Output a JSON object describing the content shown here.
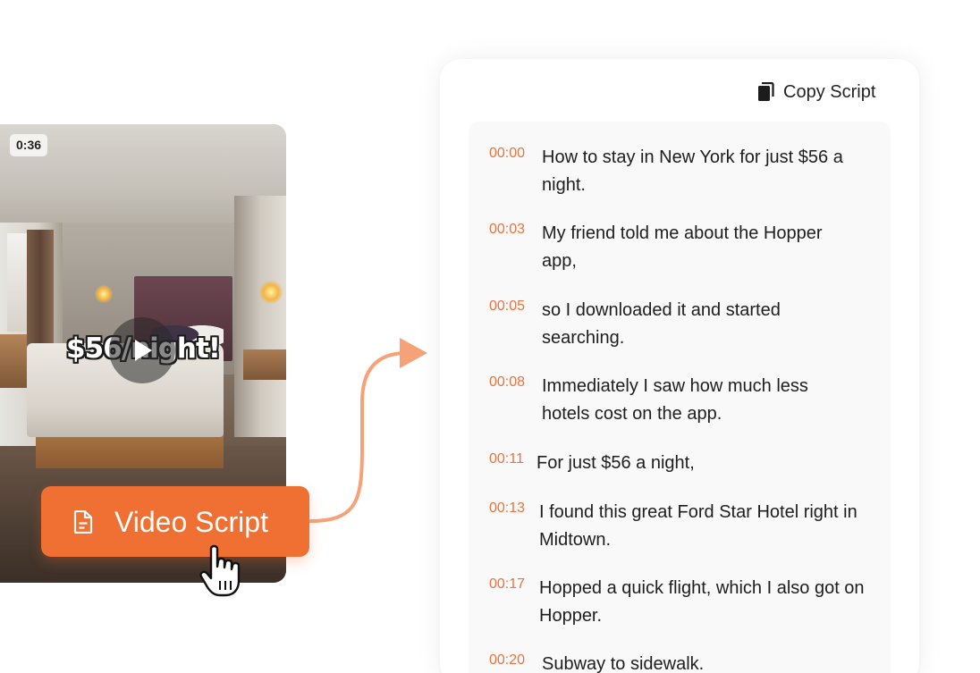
{
  "video": {
    "duration": "0:36",
    "overlay_text": "$56/night!",
    "play_icon": "play-icon"
  },
  "video_script_button": {
    "label": "Video Script",
    "icon": "document-icon",
    "color": "#f07033"
  },
  "cursor": {
    "icon": "hand-pointer-icon"
  },
  "panel": {
    "copy_label": "Copy Script",
    "copy_icon": "copy-icon",
    "accent_color": "#ea7340",
    "lines": [
      {
        "time": "00:00",
        "text": "How to stay in New York for just $56 a night."
      },
      {
        "time": "00:03",
        "text": "My friend told me about the Hopper app,"
      },
      {
        "time": "00:05",
        "text": "so I downloaded it and started searching."
      },
      {
        "time": "00:08",
        "text": "Immediately I saw how much less hotels cost on the app."
      },
      {
        "time": "00:11",
        "text": "For just $56 a night,"
      },
      {
        "time": "00:13",
        "text": "I found this great Ford Star Hotel right in Midtown."
      },
      {
        "time": "00:17",
        "text": "Hopped a quick flight, which I also got on Hopper."
      },
      {
        "time": "00:20",
        "text": "Subway to sidewalk."
      }
    ]
  }
}
